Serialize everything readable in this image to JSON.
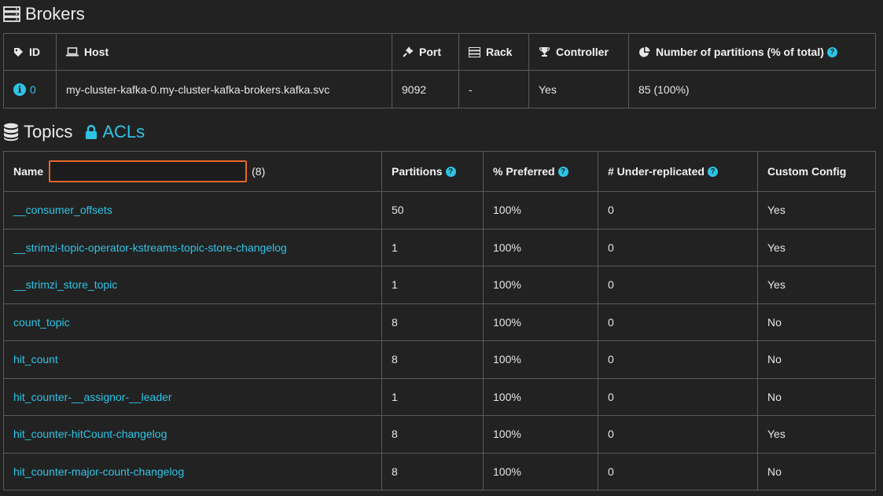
{
  "brokers": {
    "title": "Brokers",
    "columns": {
      "id": "ID",
      "host": "Host",
      "port": "Port",
      "rack": "Rack",
      "controller": "Controller",
      "partitions": "Number of partitions (% of total)"
    },
    "rows": [
      {
        "id": "0",
        "host": "my-cluster-kafka-0.my-cluster-kafka-brokers.kafka.svc",
        "port": "9092",
        "rack": "-",
        "controller": "Yes",
        "partitions": "85 (100%)"
      }
    ]
  },
  "topics": {
    "title": "Topics",
    "acls_label": "ACLs",
    "columns": {
      "name": "Name",
      "count": "(8)",
      "partitions": "Partitions",
      "preferred": "% Preferred",
      "under_replicated": "# Under-replicated",
      "custom_config": "Custom Config"
    },
    "filter_value": "",
    "rows": [
      {
        "name": "__consumer_offsets",
        "partitions": "50",
        "preferred": "100%",
        "under": "0",
        "custom": "Yes"
      },
      {
        "name": "__strimzi-topic-operator-kstreams-topic-store-changelog",
        "partitions": "1",
        "preferred": "100%",
        "under": "0",
        "custom": "Yes"
      },
      {
        "name": "__strimzi_store_topic",
        "partitions": "1",
        "preferred": "100%",
        "under": "0",
        "custom": "Yes"
      },
      {
        "name": "count_topic",
        "partitions": "8",
        "preferred": "100%",
        "under": "0",
        "custom": "No"
      },
      {
        "name": "hit_count",
        "partitions": "8",
        "preferred": "100%",
        "under": "0",
        "custom": "No"
      },
      {
        "name": "hit_counter-__assignor-__leader",
        "partitions": "1",
        "preferred": "100%",
        "under": "0",
        "custom": "No"
      },
      {
        "name": "hit_counter-hitCount-changelog",
        "partitions": "8",
        "preferred": "100%",
        "under": "0",
        "custom": "Yes"
      },
      {
        "name": "hit_counter-major-count-changelog",
        "partitions": "8",
        "preferred": "100%",
        "under": "0",
        "custom": "No"
      }
    ]
  },
  "help_glyph": "?",
  "info_glyph": "i",
  "colors": {
    "accent": "#2ec4e6",
    "background": "#222222",
    "focus": "#e8662a",
    "border": "#5a5a5a"
  }
}
